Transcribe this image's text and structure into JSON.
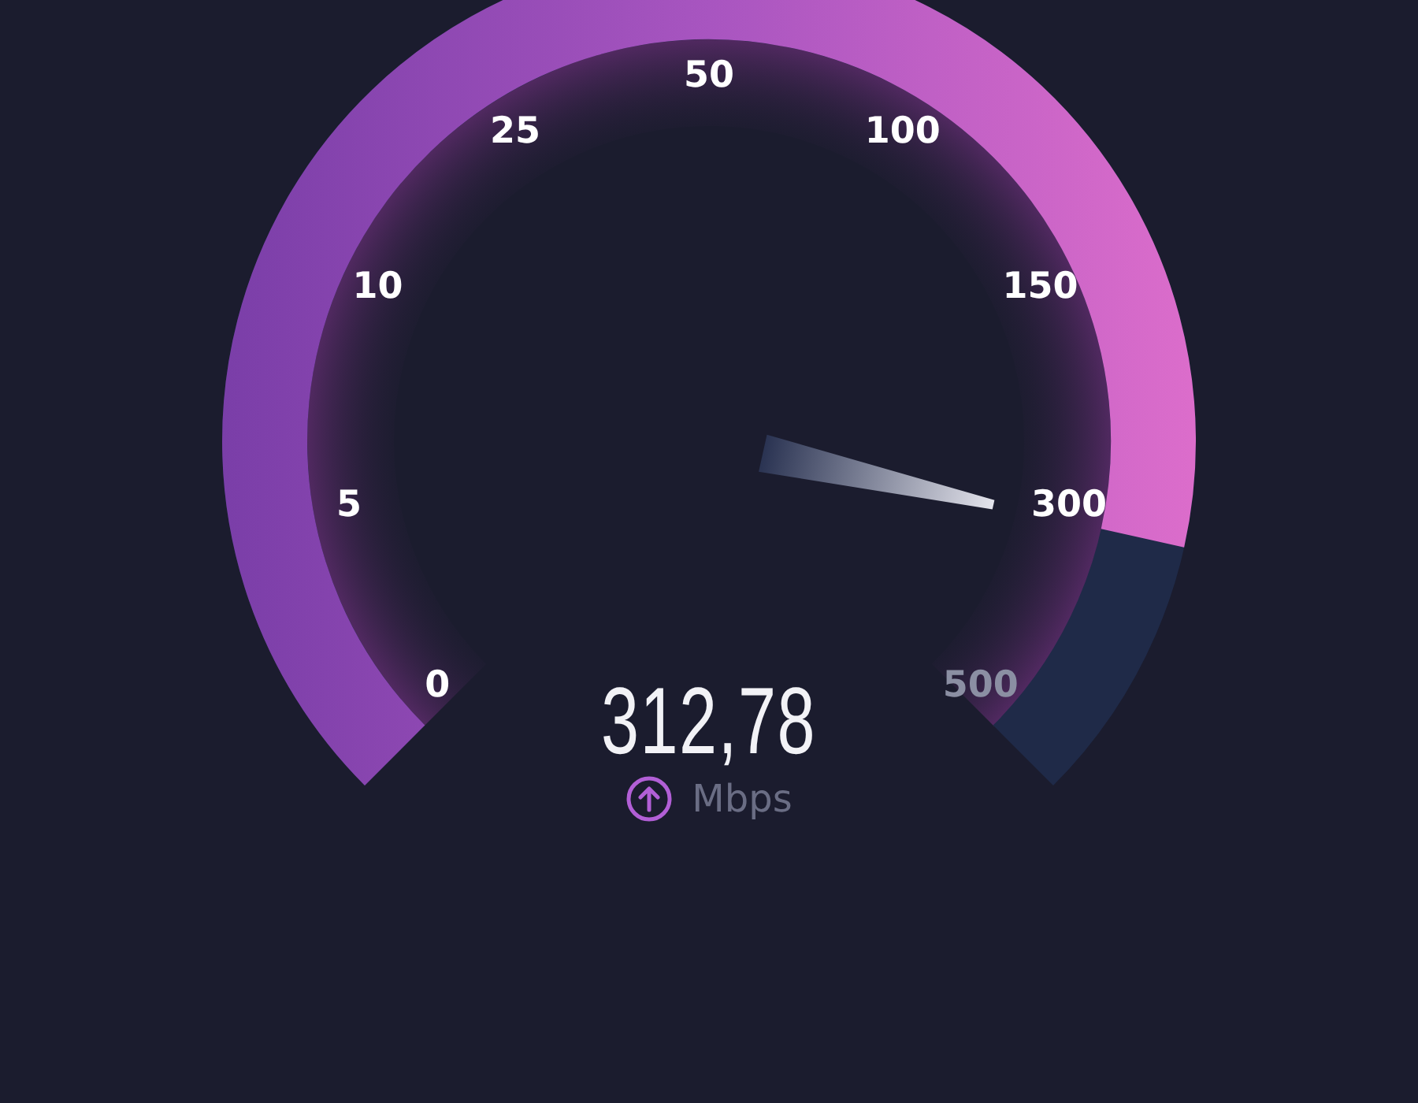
{
  "gauge": {
    "ticks": [
      {
        "label": "0",
        "reached": true
      },
      {
        "label": "5",
        "reached": true
      },
      {
        "label": "10",
        "reached": true
      },
      {
        "label": "25",
        "reached": true
      },
      {
        "label": "50",
        "reached": true
      },
      {
        "label": "100",
        "reached": true
      },
      {
        "label": "150",
        "reached": true
      },
      {
        "label": "300",
        "reached": true
      },
      {
        "label": "500",
        "reached": false
      }
    ]
  },
  "reading": {
    "value": "312,78",
    "unit": "Mbps"
  }
}
